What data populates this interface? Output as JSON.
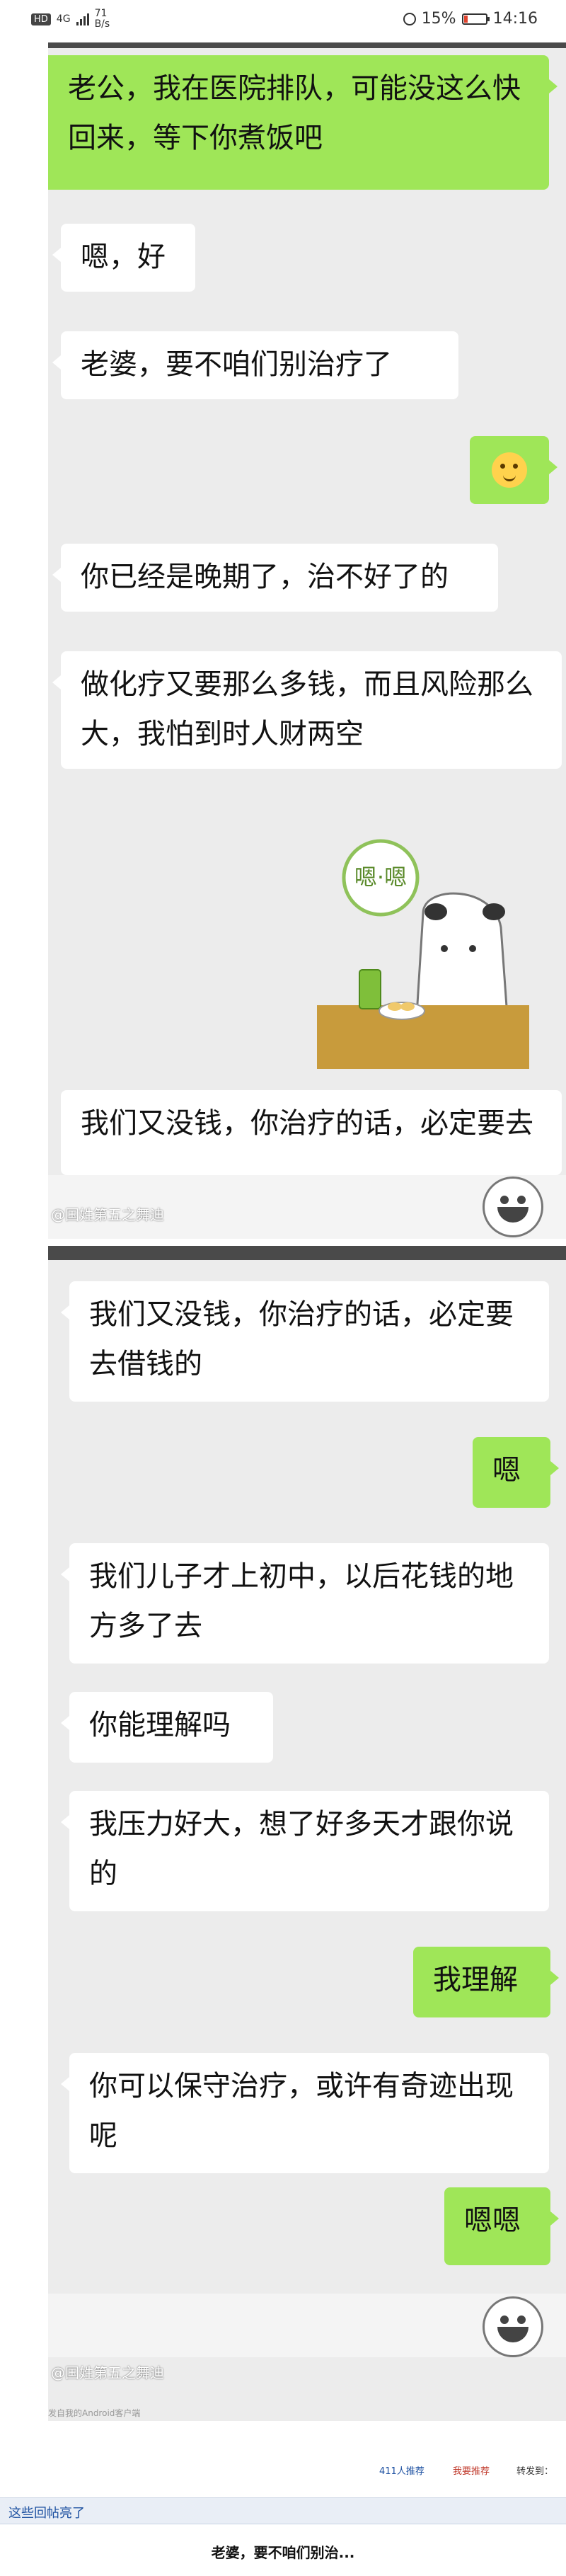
{
  "status_bar": {
    "badge": "HD",
    "network": "4G",
    "speed_value": "71",
    "speed_unit": "B/s",
    "battery": "15%",
    "time": "14:16"
  },
  "chat1": {
    "messages": [
      {
        "side": "right",
        "text": "老公，我在医院排队，可能没这么快回来，等下你煮饭吧"
      },
      {
        "side": "left",
        "text": "嗯，好"
      },
      {
        "side": "left",
        "text": "老婆，要不咱们别治疗了"
      },
      {
        "side": "right",
        "type": "emoji",
        "icon": "blush-emoji-icon"
      },
      {
        "side": "left",
        "text": "你已经是晚期了，治不好了的"
      },
      {
        "side": "left",
        "text": "做化疗又要那么多钱，而且风险那么大，我怕到时人财两空"
      },
      {
        "side": "left",
        "type": "sticker",
        "sticker_text": "嗯·嗯"
      },
      {
        "side": "left",
        "text": "我们又没钱，你治疗的话，必定要去"
      }
    ],
    "watermark": "@国姓第五之舞迪"
  },
  "chat2": {
    "messages": [
      {
        "side": "left",
        "text": "我们又没钱，你治疗的话，必定要去借钱的"
      },
      {
        "side": "right",
        "text": "嗯"
      },
      {
        "side": "left",
        "text": "我们儿子才上初中，以后花钱的地方多了去"
      },
      {
        "side": "left",
        "text": "你能理解吗"
      },
      {
        "side": "left",
        "text": "我压力好大，想了好多天才跟你说的"
      },
      {
        "side": "right",
        "text": "我理解"
      },
      {
        "side": "left",
        "text": "你可以保守治疗，或许有奇迹出现呢"
      },
      {
        "side": "right",
        "text": "嗯嗯"
      }
    ],
    "watermark": "@国姓第五之舞迪"
  },
  "page": {
    "source_line": "发自我的Android客户端",
    "views_count": "411人推荐",
    "recommend_label": "我要推荐",
    "share_label": "转发到：",
    "reply_banner": "这些回帖亮了",
    "footer_title": "老婆，要不咱们别治..."
  },
  "colors": {
    "chat_bg": "#ececec",
    "right_bubble": "#9fe658",
    "left_bubble": "#ffffff"
  }
}
